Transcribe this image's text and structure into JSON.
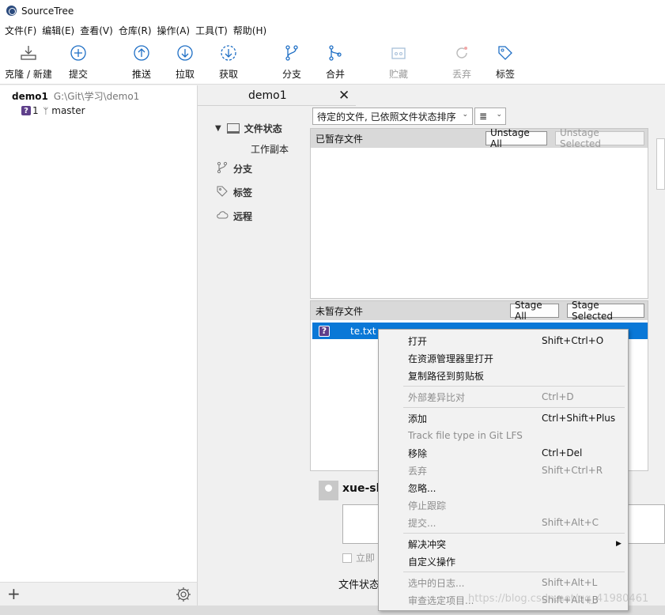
{
  "window": {
    "title": "SourceTree"
  },
  "menubar": [
    "文件(F)",
    "编辑(E)",
    "查看(V)",
    "仓库(R)",
    "操作(A)",
    "工具(T)",
    "帮助(H)"
  ],
  "toolbar": {
    "clone": "克隆 / 新建",
    "commit": "提交",
    "push": "推送",
    "pull": "拉取",
    "fetch": "获取",
    "branch": "分支",
    "merge": "合并",
    "stash": "贮藏",
    "discard": "丢弃",
    "tag": "标签"
  },
  "sidebar": {
    "repo_name": "demo1",
    "repo_path": "G:\\Git\\学习\\demo1",
    "badge": "?",
    "badge_count": "1",
    "branch_glyph": "ᛘ",
    "branch": "master"
  },
  "tab": {
    "label": "demo1",
    "close": "✕"
  },
  "repo_nav": {
    "file_status": "文件状态",
    "working_copy": "工作副本",
    "branches": "分支",
    "tags": "标签",
    "remotes": "远程"
  },
  "filter": {
    "dropdown": "待定的文件, 已依照文件状态排序",
    "view_icon": "≣"
  },
  "staged": {
    "title": "已暂存文件",
    "unstage_all": "Unstage All",
    "unstage_selected": "Unstage Selected"
  },
  "unstaged": {
    "title": "未暂存文件",
    "stage_all": "Stage All",
    "stage_selected": "Stage Selected",
    "files": [
      {
        "status": "?",
        "name": "te.txt"
      }
    ]
  },
  "commit": {
    "user": "xue-sh",
    "push_label": "立即",
    "status_label": "文件状态"
  },
  "context_menu": {
    "open": {
      "label": "打开",
      "key": "Shift+Ctrl+O"
    },
    "open_explorer": {
      "label": "在资源管理器里打开",
      "key": ""
    },
    "copy_path": {
      "label": "复制路径到剪贴板",
      "key": ""
    },
    "external_diff": {
      "label": "外部差异比对",
      "key": "Ctrl+D"
    },
    "add": {
      "label": "添加",
      "key": "Ctrl+Shift+Plus"
    },
    "lfs": {
      "label": "Track file type in Git LFS",
      "key": ""
    },
    "remove": {
      "label": "移除",
      "key": "Ctrl+Del"
    },
    "discard": {
      "label": "丢弃",
      "key": "Shift+Ctrl+R"
    },
    "ignore": {
      "label": "忽略...",
      "key": ""
    },
    "stop_tracking": {
      "label": "停止跟踪",
      "key": ""
    },
    "commit": {
      "label": "提交...",
      "key": "Shift+Alt+C"
    },
    "resolve": {
      "label": "解决冲突",
      "key": ""
    },
    "custom": {
      "label": "自定义操作",
      "key": ""
    },
    "log": {
      "label": "选中的日志...",
      "key": "Shift+Alt+L"
    },
    "annotate": {
      "label": "审查选定项目...",
      "key": "Shift+Alt+B"
    }
  },
  "watermark": "https://blog.csdn.net/qq_41980461",
  "colors": {
    "selection": "#0a78d7",
    "badge": "#5e3f8a",
    "toolbar_icon": "#1f6fc5"
  }
}
